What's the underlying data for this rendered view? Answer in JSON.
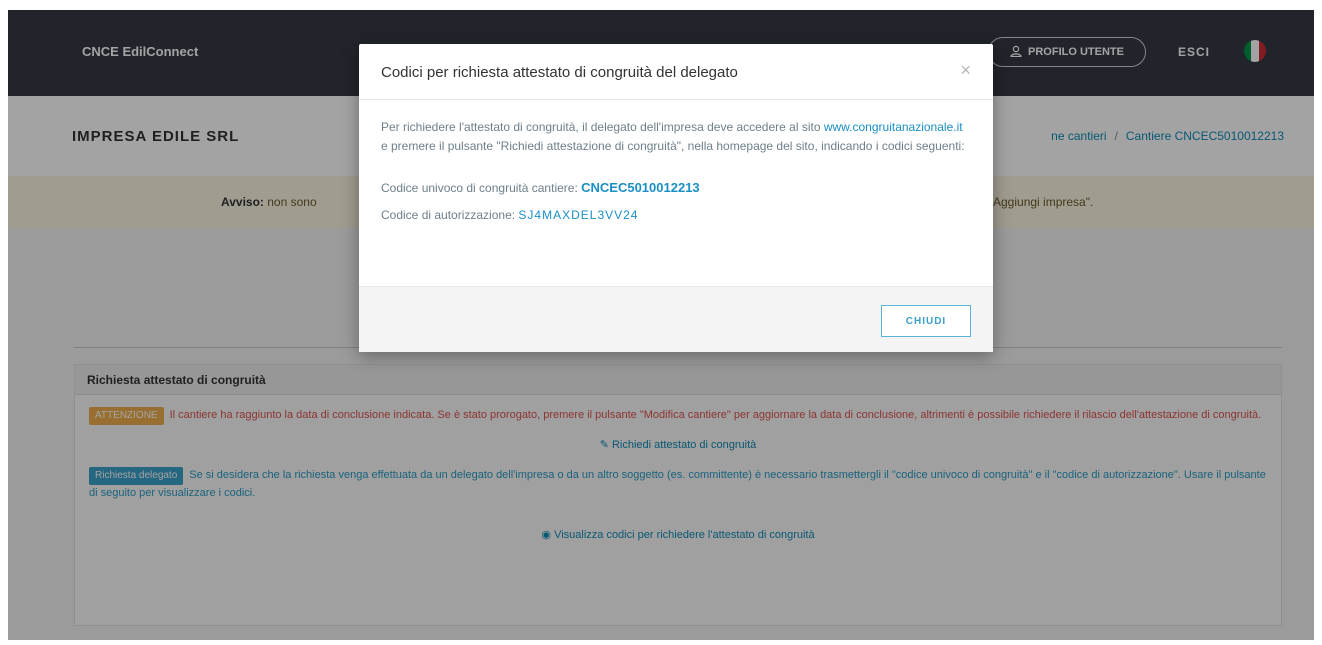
{
  "header": {
    "brand": "CNCE EdilConnect",
    "profile_label": "PROFILO UTENTE",
    "logout_label": "ESCI",
    "flag_colors": [
      "#009246",
      "#ffffff",
      "#ce2b37"
    ]
  },
  "company": {
    "name": "IMPRESA EDILE SRL",
    "breadcrumb": [
      "ne cantieri",
      "Cantiere CNCEC5010012213"
    ]
  },
  "alert": {
    "bold": "Avviso:",
    "text": " non sono",
    "right_text": "Aggiungi impresa\"."
  },
  "panel": {
    "title": "Richiesta attestato di congruità",
    "warning_badge": "ATTENZIONE",
    "warning_text": "Il cantiere ha raggiunto la data di conclusione indicata. Se è stato prorogato, premere il pulsante \"Modifica cantiere\" per aggiornare la data di conclusione, altrimenti è possibile richiedere il rilascio dell'attestazione di congruità.",
    "request_link": "Richiedi attestato di congruità",
    "info_badge": "Richiesta delegato",
    "info_text": "Se si desidera che la richiesta venga effettuata da un delegato dell'impresa o da un altro soggetto (es. committente) è necessario trasmettergli il \"codice univoco di congruità\" e il \"codice di autorizzazione\". Usare il pulsante di seguito per visualizzare i codici.",
    "view_codes_link": "Visualizza codici per richiedere l'attestato di congruità"
  },
  "modal": {
    "title": "Codici per richiesta attestato di congruità del delegato",
    "close_symbol": "×",
    "intro_part1": "Per richiedere l'attestato di congruità, il delegato dell'impresa deve accedere al sito ",
    "intro_link": "www.congruitanazionale.it",
    "intro_part2": " e premere il pulsante \"Richiedi attestazione di congruità\", nella homepage del sito, indicando i codici seguenti:",
    "code_label": "Codice univoco di congruità cantiere:",
    "code_value": "CNCEC5010012213",
    "auth_label": "Codice di autorizzazione:",
    "auth_value": "SJ4MAXDEL3VV24",
    "close_button": "CHIUDI"
  }
}
